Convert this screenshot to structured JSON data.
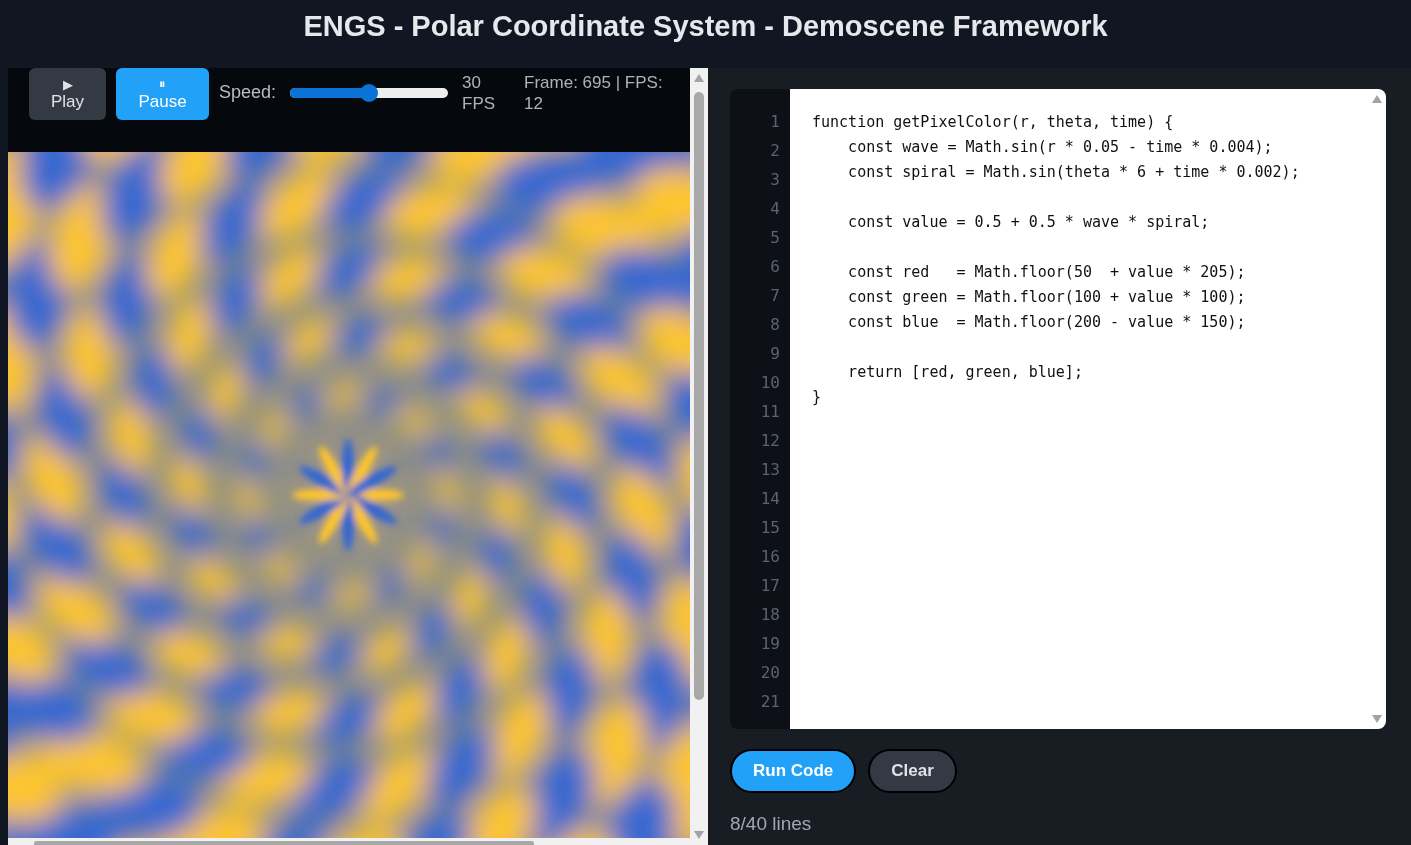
{
  "header": {
    "title": "ENGS - Polar Coordinate System - Demoscene Framework"
  },
  "controls": {
    "buttons": [
      {
        "icon": "▶",
        "label": "Play",
        "active": false
      },
      {
        "icon": "⏸",
        "label": "Pause",
        "active": true
      }
    ],
    "speed": {
      "label": "Speed:",
      "level": 0.5,
      "reading": "30 FPS"
    },
    "stats": "Frame: 695 | FPS: 12"
  },
  "editor": {
    "line_numbers": [
      "1",
      "2",
      "3",
      "4",
      "5",
      "6",
      "7",
      "8",
      "9",
      "10",
      "11",
      "12",
      "13",
      "14",
      "15",
      "16",
      "17",
      "18",
      "19",
      "20",
      "21"
    ],
    "code": "function getPixelColor(r, theta, time) {\n    const wave = Math.sin(r * 0.05 - time * 0.004);\n    const spiral = Math.sin(theta * 6 + time * 0.002);\n\n    const value = 0.5 + 0.5 * wave * spiral;\n\n    const red   = Math.floor(50  + value * 205);\n    const green = Math.floor(100 + value * 100);\n    const blue  = Math.floor(200 - value * 150);\n\n    return [red, green, blue];\n}"
  },
  "actions": [
    {
      "label": "Run Code",
      "kind": "primary"
    },
    {
      "label": "Clear",
      "kind": "secondary"
    }
  ],
  "status": "8/40 lines"
}
